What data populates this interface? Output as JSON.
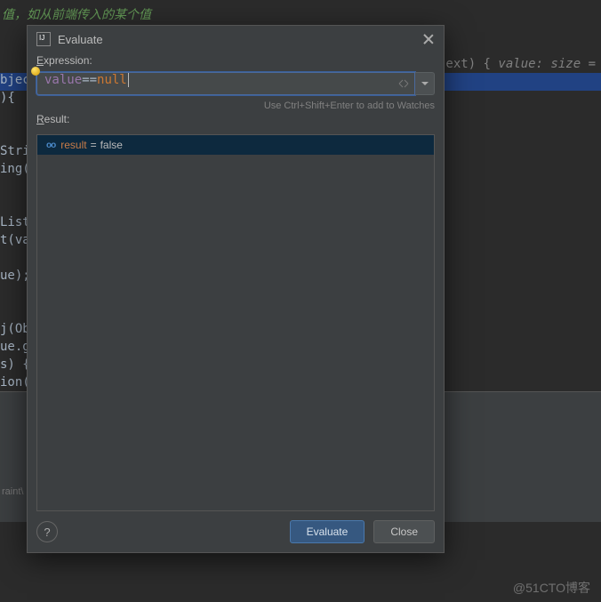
{
  "background": {
    "comment": "值，如从前端传入的某个值",
    "code_lines": [
      "",
      "bjec",
      "){",
      "",
      "",
      "Stri",
      "ing(",
      "",
      "",
      "List",
      "t(va",
      "",
      "ue);",
      "",
      "",
      "j(Ob",
      "ue.g",
      "s) {",
      "ion("
    ],
    "right_snippet_pre": "ext) {   ",
    "right_snippet_it": "value:  size =",
    "footer": "raint\\"
  },
  "dialog": {
    "title": "Evaluate",
    "expression_label_pre": "E",
    "expression_label_rest": "xpression:",
    "expression_value_prop": "value",
    "expression_value_op": "==",
    "expression_value_kw": "null",
    "hint": "Use Ctrl+Shift+Enter to add to Watches",
    "result_label_pre": "R",
    "result_label_rest": "esult:",
    "result_name": "result",
    "result_eq": "=",
    "result_value": "false",
    "evaluate_btn": "Evaluate",
    "close_btn": "Close",
    "help": "?"
  },
  "watermark": "@51CTO博客"
}
